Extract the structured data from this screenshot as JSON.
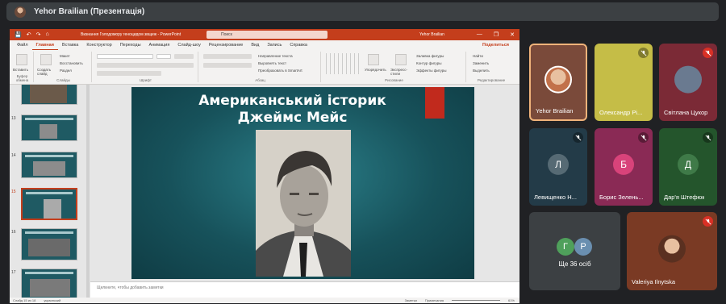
{
  "meet": {
    "presenter_label": "Yehor Brailian (Презентація)"
  },
  "ppt": {
    "quick_access": [
      "💾",
      "↶",
      "↷",
      "⌂"
    ],
    "doc_title": "Визнання Голодомору геноцидом звщеж - PowerPoint",
    "search_placeholder": "Поиск",
    "user": "Yehor Brailian",
    "window_controls": [
      "—",
      "❐",
      "✕"
    ],
    "tabs": [
      "Файл",
      "Главная",
      "Вставка",
      "Конструктор",
      "Переходы",
      "Анимация",
      "Слайд-шоу",
      "Рецензирование",
      "Вид",
      "Запись",
      "Справка"
    ],
    "active_tab": "Главная",
    "share": "Поделиться",
    "ribbon": {
      "paste": "Вставить",
      "clipboard": "Буфер обмена",
      "new_slide": "Создать слайд",
      "layout": "Макет",
      "reset": "Восстановить",
      "section": "Раздел",
      "slides_group": "Слайды",
      "font_group": "Шрифт",
      "paragraph_group": "Абзац",
      "text_direction": "Направление текста",
      "align_text": "Выровнять текст",
      "smartart": "Преобразовать в SmartArt",
      "arrange": "Упорядочить",
      "quick_styles": "Экспресс-стили",
      "shape_fill": "Заливка фигуры",
      "shape_outline": "Контур фигуры",
      "shape_effects": "Эффекты фигуры",
      "drawing_group": "Рисование",
      "find": "Найти",
      "replace": "Заменить",
      "select": "Выделить",
      "editing_group": "Редактирование"
    },
    "slide_numbers": [
      "12",
      "13",
      "14",
      "15",
      "16",
      "17"
    ],
    "slide_title_line1": "Американський історик",
    "slide_title_line2": "Джеймс Мейс",
    "notes_placeholder": "Щелкните, чтобы добавить заметки",
    "status_left": "Слайд 15 из 18",
    "status_lang": "украинский",
    "status_notes": "Заметки",
    "status_comments": "Примечания",
    "zoom": "61%"
  },
  "participants": [
    {
      "name": "Yehor Brailian",
      "bg": "#7a4a3a",
      "type": "photo",
      "muted": false,
      "speaking": true
    },
    {
      "name": "Олександр Рі...",
      "bg": "#c5bd47",
      "type": "photo",
      "muted": true
    },
    {
      "name": "Світлана Цукор",
      "bg": "#7b2a36",
      "type": "photo",
      "muted": true
    },
    {
      "name": "Левищенко Н...",
      "bg": "#233b48",
      "type": "letter",
      "letter": "Л",
      "letter_bg": "#566a74",
      "muted": true
    },
    {
      "name": "Борис Зелень...",
      "bg": "#8a2a55",
      "type": "letter",
      "letter": "Б",
      "letter_bg": "#d8437a",
      "muted": true
    },
    {
      "name": "Дар'я Штефюк",
      "bg": "#24552c",
      "type": "letter",
      "letter": "Д",
      "letter_bg": "#3f7a48",
      "muted": true
    },
    {
      "name": "Valeriya Ilnytska",
      "bg": "#7a3a24",
      "type": "photo",
      "muted": true
    }
  ],
  "others": {
    "label": "Ще 36 осіб",
    "letters": [
      "Г",
      "Р"
    ],
    "colors": [
      "#4fa05b",
      "#6a8fb0"
    ]
  }
}
